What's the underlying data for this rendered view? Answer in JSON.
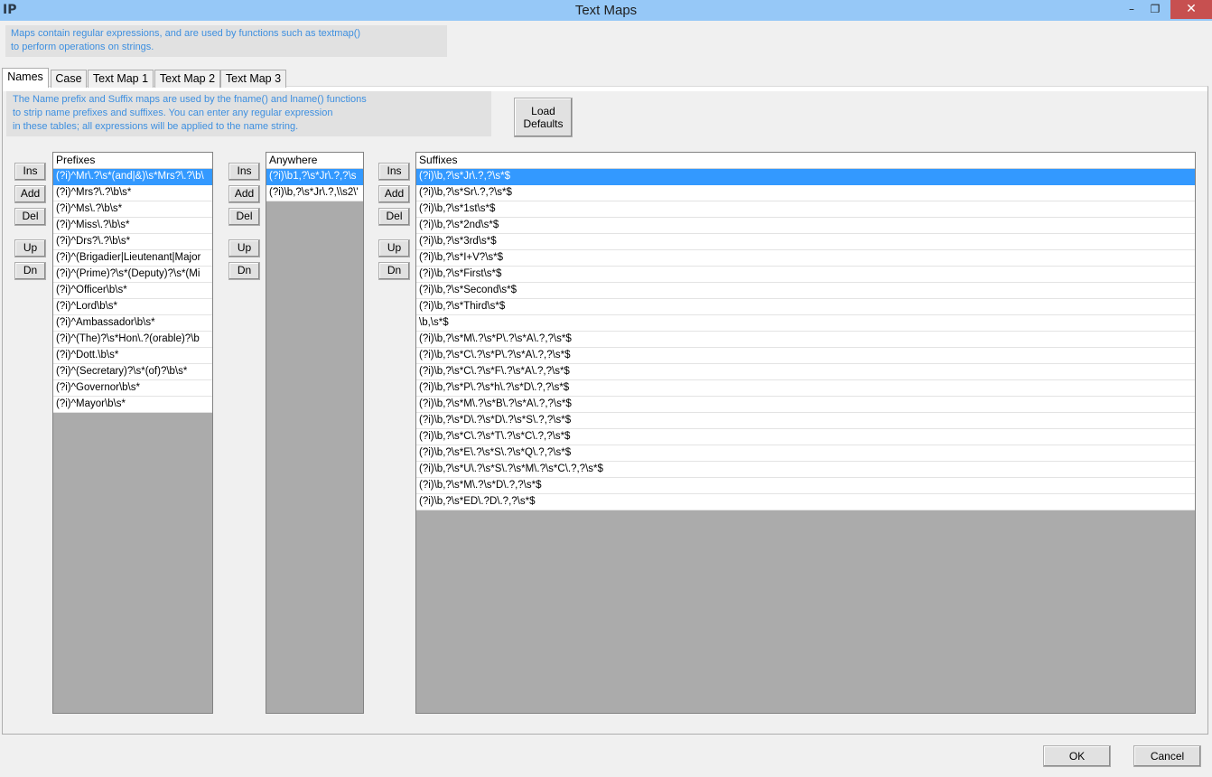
{
  "window": {
    "title": "Text Maps",
    "icon": "app-logo-icon",
    "app_icon_glyph": "IP",
    "min_glyph": "–",
    "max_glyph": "❐",
    "close_glyph": "✕"
  },
  "info": {
    "line1": "Maps contain regular expressions, and are used by functions such as textmap()",
    "line2": "to perform operations on strings."
  },
  "tabs": [
    {
      "label": "Names",
      "active": true
    },
    {
      "label": "Case"
    },
    {
      "label": "Text Map 1"
    },
    {
      "label": "Text Map 2"
    },
    {
      "label": "Text Map 3"
    }
  ],
  "names_info": {
    "line1": "The Name prefix and Suffix maps are used by the fname() and lname() functions",
    "line2": "to strip name prefixes and suffixes. You can enter any regular expression",
    "line3": "in these tables; all expressions will be applied to the name string."
  },
  "load_defaults": {
    "line1": "Load",
    "line2": "Defaults"
  },
  "controls": {
    "ins": "Ins",
    "add": "Add",
    "del": "Del",
    "up": "Up",
    "dn": "Dn"
  },
  "prefixes": {
    "header": "Prefixes",
    "rows": [
      "(?i)^Mr\\.?\\s*(and|&)\\s*Mrs?\\.?\\b\\",
      "(?i)^Mrs?\\.?\\b\\s*",
      "(?i)^Ms\\.?\\b\\s*",
      "(?i)^Miss\\.?\\b\\s*",
      "(?i)^Drs?\\.?\\b\\s*",
      "(?i)^(Brigadier|Lieutenant|Major",
      "(?i)^(Prime)?\\s*(Deputy)?\\s*(Mi",
      "(?i)^Officer\\b\\s*",
      "(?i)^Lord\\b\\s*",
      "(?i)^Ambassador\\b\\s*",
      "(?i)^(The)?\\s*Hon\\.?(orable)?\\b",
      "(?i)^Dott.\\b\\s*",
      "(?i)^(Secretary)?\\s*(of)?\\b\\s*",
      "(?i)^Governor\\b\\s*",
      "(?i)^Mayor\\b\\s*"
    ]
  },
  "anywhere": {
    "header": "Anywhere",
    "rows": [
      "(?i)\\b1,?\\s*Jr\\.?,?\\s",
      "(?i)\\b,?\\s*Jr\\.?,\\\\s2\\'"
    ]
  },
  "suffixes": {
    "header": "Suffixes",
    "rows": [
      "(?i)\\b,?\\s*Jr\\.?,?\\s*$",
      "(?i)\\b,?\\s*Sr\\.?,?\\s*$",
      "(?i)\\b,?\\s*1st\\s*$",
      "(?i)\\b,?\\s*2nd\\s*$",
      "(?i)\\b,?\\s*3rd\\s*$",
      "(?i)\\b,?\\s*I+V?\\s*$",
      "(?i)\\b,?\\s*First\\s*$",
      "(?i)\\b,?\\s*Second\\s*$",
      "(?i)\\b,?\\s*Third\\s*$",
      "\\b,\\s*$",
      "(?i)\\b,?\\s*M\\.?\\s*P\\.?\\s*A\\.?,?\\s*$",
      "(?i)\\b,?\\s*C\\.?\\s*P\\.?\\s*A\\.?,?\\s*$",
      "(?i)\\b,?\\s*C\\.?\\s*F\\.?\\s*A\\.?,?\\s*$",
      "(?i)\\b,?\\s*P\\.?\\s*h\\.?\\s*D\\.?,?\\s*$",
      "(?i)\\b,?\\s*M\\.?\\s*B\\.?\\s*A\\.?,?\\s*$",
      "(?i)\\b,?\\s*D\\.?\\s*D\\.?\\s*S\\.?,?\\s*$",
      "(?i)\\b,?\\s*C\\.?\\s*T\\.?\\s*C\\.?,?\\s*$",
      "(?i)\\b,?\\s*E\\.?\\s*S\\.?\\s*Q\\.?,?\\s*$",
      "(?i)\\b,?\\s*U\\.?\\s*S\\.?\\s*M\\.?\\s*C\\.?,?\\s*$",
      "(?i)\\b,?\\s*M\\.?\\s*D\\.?,?\\s*$",
      "(?i)\\b,?\\s*ED\\.?D\\.?,?\\s*$"
    ]
  },
  "footer": {
    "ok": "OK",
    "cancel": "Cancel"
  }
}
